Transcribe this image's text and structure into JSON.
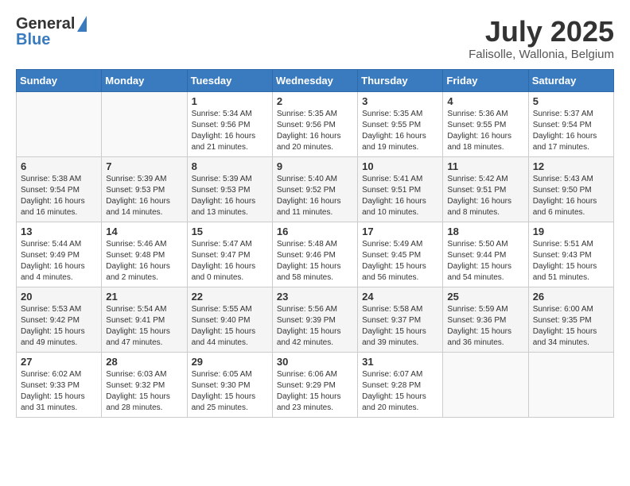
{
  "header": {
    "logo_general": "General",
    "logo_blue": "Blue",
    "month": "July 2025",
    "location": "Falisolle, Wallonia, Belgium"
  },
  "weekdays": [
    "Sunday",
    "Monday",
    "Tuesday",
    "Wednesday",
    "Thursday",
    "Friday",
    "Saturday"
  ],
  "weeks": [
    [
      {
        "day": "",
        "sunrise": "",
        "sunset": "",
        "daylight": ""
      },
      {
        "day": "",
        "sunrise": "",
        "sunset": "",
        "daylight": ""
      },
      {
        "day": "1",
        "sunrise": "Sunrise: 5:34 AM",
        "sunset": "Sunset: 9:56 PM",
        "daylight": "Daylight: 16 hours and 21 minutes."
      },
      {
        "day": "2",
        "sunrise": "Sunrise: 5:35 AM",
        "sunset": "Sunset: 9:56 PM",
        "daylight": "Daylight: 16 hours and 20 minutes."
      },
      {
        "day": "3",
        "sunrise": "Sunrise: 5:35 AM",
        "sunset": "Sunset: 9:55 PM",
        "daylight": "Daylight: 16 hours and 19 minutes."
      },
      {
        "day": "4",
        "sunrise": "Sunrise: 5:36 AM",
        "sunset": "Sunset: 9:55 PM",
        "daylight": "Daylight: 16 hours and 18 minutes."
      },
      {
        "day": "5",
        "sunrise": "Sunrise: 5:37 AM",
        "sunset": "Sunset: 9:54 PM",
        "daylight": "Daylight: 16 hours and 17 minutes."
      }
    ],
    [
      {
        "day": "6",
        "sunrise": "Sunrise: 5:38 AM",
        "sunset": "Sunset: 9:54 PM",
        "daylight": "Daylight: 16 hours and 16 minutes."
      },
      {
        "day": "7",
        "sunrise": "Sunrise: 5:39 AM",
        "sunset": "Sunset: 9:53 PM",
        "daylight": "Daylight: 16 hours and 14 minutes."
      },
      {
        "day": "8",
        "sunrise": "Sunrise: 5:39 AM",
        "sunset": "Sunset: 9:53 PM",
        "daylight": "Daylight: 16 hours and 13 minutes."
      },
      {
        "day": "9",
        "sunrise": "Sunrise: 5:40 AM",
        "sunset": "Sunset: 9:52 PM",
        "daylight": "Daylight: 16 hours and 11 minutes."
      },
      {
        "day": "10",
        "sunrise": "Sunrise: 5:41 AM",
        "sunset": "Sunset: 9:51 PM",
        "daylight": "Daylight: 16 hours and 10 minutes."
      },
      {
        "day": "11",
        "sunrise": "Sunrise: 5:42 AM",
        "sunset": "Sunset: 9:51 PM",
        "daylight": "Daylight: 16 hours and 8 minutes."
      },
      {
        "day": "12",
        "sunrise": "Sunrise: 5:43 AM",
        "sunset": "Sunset: 9:50 PM",
        "daylight": "Daylight: 16 hours and 6 minutes."
      }
    ],
    [
      {
        "day": "13",
        "sunrise": "Sunrise: 5:44 AM",
        "sunset": "Sunset: 9:49 PM",
        "daylight": "Daylight: 16 hours and 4 minutes."
      },
      {
        "day": "14",
        "sunrise": "Sunrise: 5:46 AM",
        "sunset": "Sunset: 9:48 PM",
        "daylight": "Daylight: 16 hours and 2 minutes."
      },
      {
        "day": "15",
        "sunrise": "Sunrise: 5:47 AM",
        "sunset": "Sunset: 9:47 PM",
        "daylight": "Daylight: 16 hours and 0 minutes."
      },
      {
        "day": "16",
        "sunrise": "Sunrise: 5:48 AM",
        "sunset": "Sunset: 9:46 PM",
        "daylight": "Daylight: 15 hours and 58 minutes."
      },
      {
        "day": "17",
        "sunrise": "Sunrise: 5:49 AM",
        "sunset": "Sunset: 9:45 PM",
        "daylight": "Daylight: 15 hours and 56 minutes."
      },
      {
        "day": "18",
        "sunrise": "Sunrise: 5:50 AM",
        "sunset": "Sunset: 9:44 PM",
        "daylight": "Daylight: 15 hours and 54 minutes."
      },
      {
        "day": "19",
        "sunrise": "Sunrise: 5:51 AM",
        "sunset": "Sunset: 9:43 PM",
        "daylight": "Daylight: 15 hours and 51 minutes."
      }
    ],
    [
      {
        "day": "20",
        "sunrise": "Sunrise: 5:53 AM",
        "sunset": "Sunset: 9:42 PM",
        "daylight": "Daylight: 15 hours and 49 minutes."
      },
      {
        "day": "21",
        "sunrise": "Sunrise: 5:54 AM",
        "sunset": "Sunset: 9:41 PM",
        "daylight": "Daylight: 15 hours and 47 minutes."
      },
      {
        "day": "22",
        "sunrise": "Sunrise: 5:55 AM",
        "sunset": "Sunset: 9:40 PM",
        "daylight": "Daylight: 15 hours and 44 minutes."
      },
      {
        "day": "23",
        "sunrise": "Sunrise: 5:56 AM",
        "sunset": "Sunset: 9:39 PM",
        "daylight": "Daylight: 15 hours and 42 minutes."
      },
      {
        "day": "24",
        "sunrise": "Sunrise: 5:58 AM",
        "sunset": "Sunset: 9:37 PM",
        "daylight": "Daylight: 15 hours and 39 minutes."
      },
      {
        "day": "25",
        "sunrise": "Sunrise: 5:59 AM",
        "sunset": "Sunset: 9:36 PM",
        "daylight": "Daylight: 15 hours and 36 minutes."
      },
      {
        "day": "26",
        "sunrise": "Sunrise: 6:00 AM",
        "sunset": "Sunset: 9:35 PM",
        "daylight": "Daylight: 15 hours and 34 minutes."
      }
    ],
    [
      {
        "day": "27",
        "sunrise": "Sunrise: 6:02 AM",
        "sunset": "Sunset: 9:33 PM",
        "daylight": "Daylight: 15 hours and 31 minutes."
      },
      {
        "day": "28",
        "sunrise": "Sunrise: 6:03 AM",
        "sunset": "Sunset: 9:32 PM",
        "daylight": "Daylight: 15 hours and 28 minutes."
      },
      {
        "day": "29",
        "sunrise": "Sunrise: 6:05 AM",
        "sunset": "Sunset: 9:30 PM",
        "daylight": "Daylight: 15 hours and 25 minutes."
      },
      {
        "day": "30",
        "sunrise": "Sunrise: 6:06 AM",
        "sunset": "Sunset: 9:29 PM",
        "daylight": "Daylight: 15 hours and 23 minutes."
      },
      {
        "day": "31",
        "sunrise": "Sunrise: 6:07 AM",
        "sunset": "Sunset: 9:28 PM",
        "daylight": "Daylight: 15 hours and 20 minutes."
      },
      {
        "day": "",
        "sunrise": "",
        "sunset": "",
        "daylight": ""
      },
      {
        "day": "",
        "sunrise": "",
        "sunset": "",
        "daylight": ""
      }
    ]
  ]
}
